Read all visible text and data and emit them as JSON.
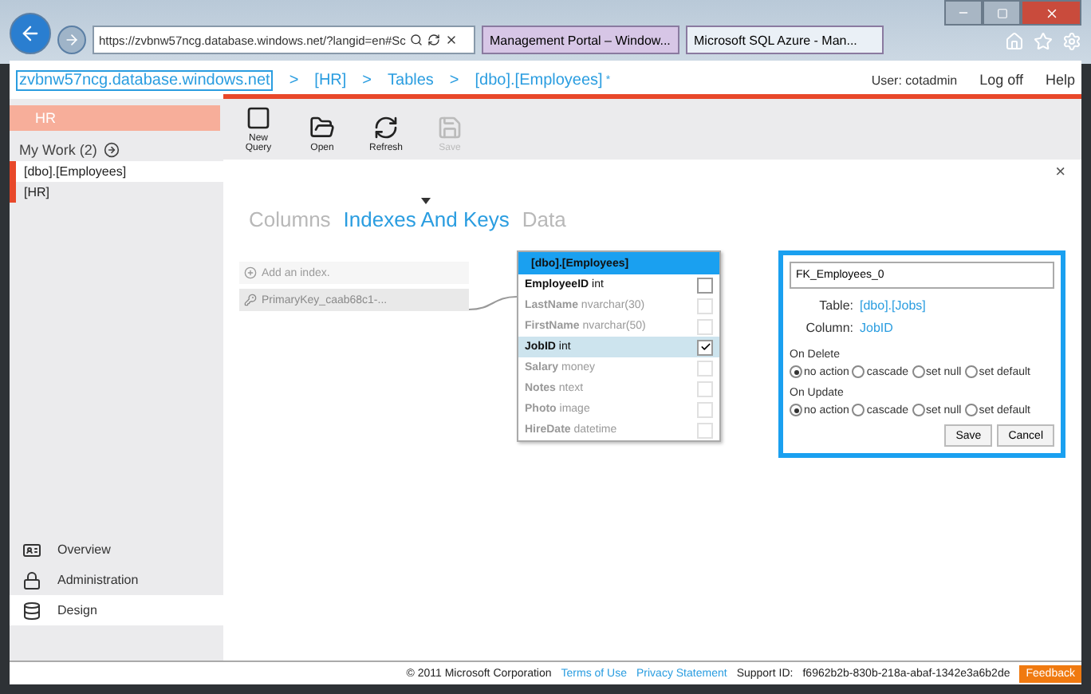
{
  "browser": {
    "address": "https://zvbnw57ncg.database.windows.net/?langid=en#Sc",
    "tabs": [
      {
        "label": "Management Portal – Window...",
        "selected": false
      },
      {
        "label": "Microsoft SQL Azure - Man...",
        "selected": true
      }
    ]
  },
  "breadcrumb": {
    "items": [
      "zvbnw57ncg.database.windows.net",
      "[HR]",
      "Tables",
      "[dbo].[Employees]"
    ],
    "separator": ">",
    "modified_mark": "*"
  },
  "user_bar": {
    "user": "User: cotadmin",
    "links": [
      "Log off",
      "Help"
    ]
  },
  "sidebar": {
    "header": "HR",
    "my_work": "My Work (2)",
    "items": [
      {
        "label": "[dbo].[Employees]",
        "selected": true
      },
      {
        "label": "[HR]",
        "selected": false
      }
    ],
    "nav": [
      {
        "label": "Overview",
        "kind": "overview",
        "selected": false
      },
      {
        "label": "Administration",
        "kind": "administration",
        "selected": false
      },
      {
        "label": "Design",
        "kind": "design",
        "selected": true
      }
    ]
  },
  "toolbar": [
    {
      "label": "New Query",
      "kind": "new",
      "disabled": false
    },
    {
      "label": "Open",
      "kind": "open",
      "disabled": false
    },
    {
      "label": "Refresh",
      "kind": "refresh",
      "disabled": false
    },
    {
      "label": "Save",
      "kind": "save",
      "disabled": true
    }
  ],
  "close": "×",
  "tabs": [
    {
      "label": "Columns",
      "selected": false
    },
    {
      "label": "Indexes And Keys",
      "selected": true
    },
    {
      "label": "Data",
      "selected": false
    }
  ],
  "indexes": {
    "add": "Add an index.",
    "items": [
      "PrimaryKey_caab68c1-..."
    ]
  },
  "table_card": {
    "title": "[dbo].[Employees]",
    "columns": [
      {
        "name": "EmployeeID",
        "type": "int",
        "active": true,
        "selected": false,
        "checked": false
      },
      {
        "name": "LastName",
        "type": "nvarchar(30)",
        "active": false,
        "selected": false,
        "checked": false
      },
      {
        "name": "FirstName",
        "type": "nvarchar(50)",
        "active": false,
        "selected": false,
        "checked": false
      },
      {
        "name": "JobID",
        "type": "int",
        "active": true,
        "selected": true,
        "checked": true
      },
      {
        "name": "Salary",
        "type": "money",
        "active": false,
        "selected": false,
        "checked": false
      },
      {
        "name": "Notes",
        "type": "ntext",
        "active": false,
        "selected": false,
        "checked": false
      },
      {
        "name": "Photo",
        "type": "image",
        "active": false,
        "selected": false,
        "checked": false
      },
      {
        "name": "HireDate",
        "type": "datetime",
        "active": false,
        "selected": false,
        "checked": false
      }
    ]
  },
  "foreign_key": {
    "name": "FK_Employees_0",
    "table_label": "Table:",
    "table": "[dbo].[Jobs]",
    "column_label": "Column:",
    "column": "JobID",
    "groups": [
      {
        "title": "On Delete",
        "options": [
          {
            "label": "no action",
            "selected": true
          },
          {
            "label": "cascade",
            "selected": false
          },
          {
            "label": "set null",
            "selected": false
          },
          {
            "label": "set default",
            "selected": false
          }
        ]
      },
      {
        "title": "On Update",
        "options": [
          {
            "label": "no action",
            "selected": true
          },
          {
            "label": "cascade",
            "selected": false
          },
          {
            "label": "set null",
            "selected": false
          },
          {
            "label": "set default",
            "selected": false
          }
        ]
      }
    ],
    "buttons": [
      "Save",
      "Cancel"
    ]
  },
  "footer": {
    "copyright": "© 2011 Microsoft Corporation",
    "links": [
      "Terms of Use",
      "Privacy Statement"
    ],
    "support": "Support ID:",
    "support_id": "f6962b2b-830b-218a-abaf-1342e3a6b2de",
    "feedback": "Feedback"
  }
}
